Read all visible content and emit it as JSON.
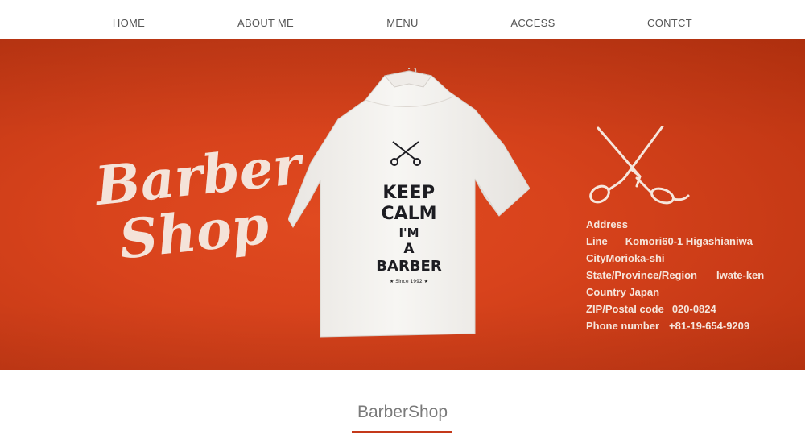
{
  "nav": {
    "items": [
      {
        "label": "HOME"
      },
      {
        "label": "ABOUT ME"
      },
      {
        "label": "MENU"
      },
      {
        "label": "ACCESS"
      },
      {
        "label": "CONTCT"
      }
    ]
  },
  "hero": {
    "logo": {
      "line1": "Barber",
      "line2": "Shop"
    },
    "shirt": {
      "line1": "KEEP",
      "line2": "CALM",
      "line3": "I'M",
      "line4": "A",
      "line5": "BARBER",
      "since": "★ Since 1992 ★"
    },
    "address": {
      "heading": "Address",
      "line_label": "Line",
      "line_value": "Komori60-1 Higashianiwa",
      "city": "CityMorioka-shi",
      "state_label": "State/Province/Region",
      "state_value": "Iwate-ken",
      "country": "Country Japan",
      "zip_label": "ZIP/Postal code",
      "zip_value": "020-0824",
      "phone_label": "Phone number",
      "phone_value": "+81-19-654-9209"
    }
  },
  "section": {
    "title": "BarberShop"
  },
  "colors": {
    "hero_bg": "#d8431c",
    "accent": "#c4391a",
    "text_light": "#f6e6dc"
  },
  "icons": [
    "scissors-icon"
  ]
}
